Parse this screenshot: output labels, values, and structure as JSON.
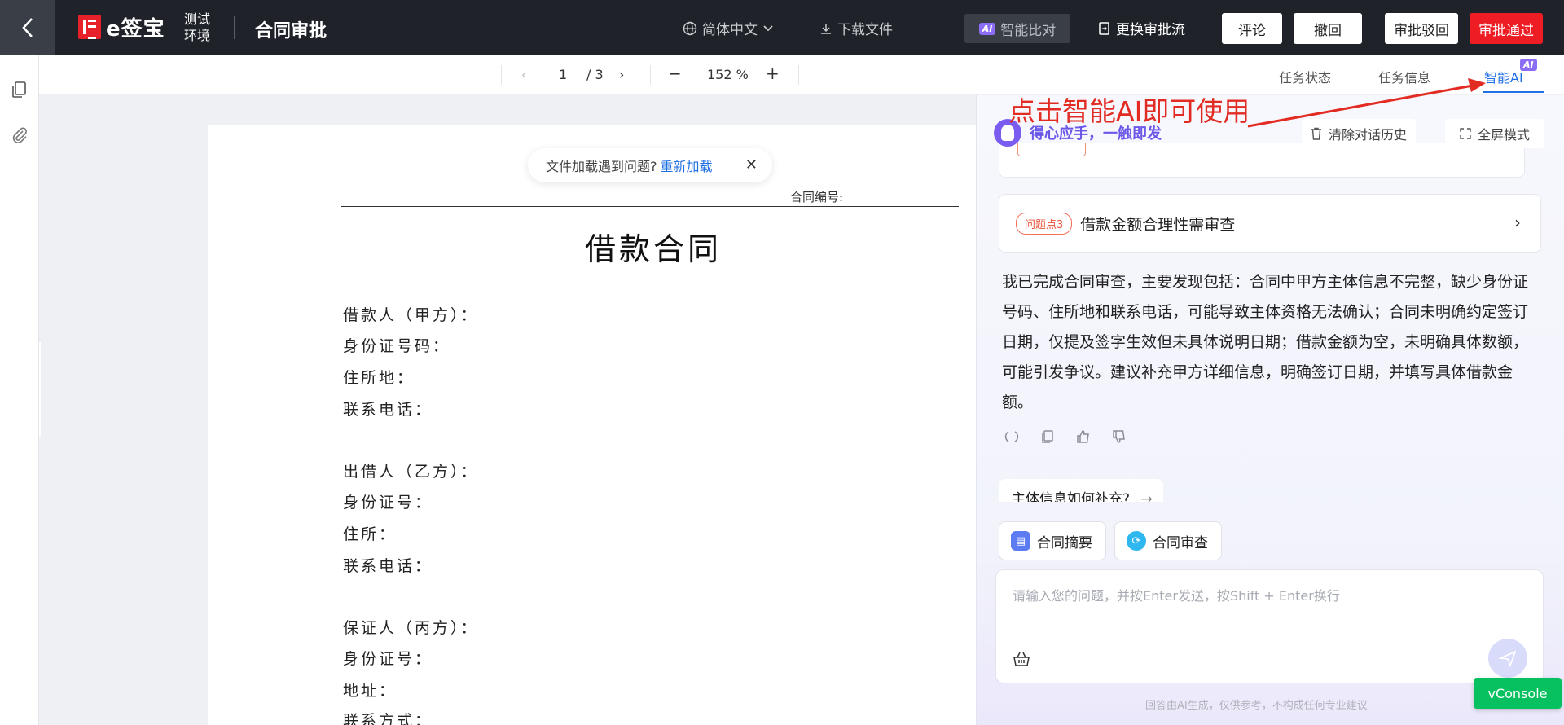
{
  "topbar": {
    "logo_text": "e签宝",
    "env_label": "测试环境",
    "title": "合同审批",
    "language": "简体中文",
    "download": "下载文件",
    "ai_badge": "AI",
    "ai_compare": "智能比对",
    "change_flow": "更换审批流",
    "buttons": {
      "comment": "评论",
      "withdraw": "撤回",
      "reject": "审批驳回",
      "approve": "审批通过"
    },
    "colors": {
      "bar": "#1f2329",
      "approve": "#ee1d23"
    }
  },
  "viewer": {
    "current_page": "1",
    "total_pages": "/ 3",
    "zoom": "152 %"
  },
  "right_tabs": {
    "task_status": "任务状态",
    "task_info": "任务信息",
    "smart_ai": "智能AI",
    "ai_superscript": "AI"
  },
  "toast": {
    "message": "文件加载遇到问题?",
    "action": "重新加载"
  },
  "document": {
    "contract_no_label": "合同编号:",
    "title": "借款合同",
    "fields": [
      "借款人（甲方）：",
      "身份证号码：",
      "住所地：",
      "联系电话：",
      "出借人（乙方）：",
      "身份证号：",
      "住所：",
      "联系电话：",
      "保证人（丙方）：",
      "身份证号：",
      "地址：",
      "联系方式："
    ]
  },
  "ai_panel": {
    "slogan": "得心应手，一触即发",
    "clear_history": "清除对话历史",
    "fullscreen": "全屏模式",
    "issue": {
      "tag": "问题点3",
      "text": "借款金额合理性需审查"
    },
    "answer": "我已完成合同审查，主要发现包括：合同中甲方主体信息不完整，缺少身份证号码、住所地和联系电话，可能导致主体资格无法确认；合同未明确约定签订日期，仅提及签字生效但未具体说明日期；借款金额为空，未明确具体数额，可能引发争议。建议补充甲方详细信息，明确签订日期，并填写具体借款金额。",
    "suggestion": "主体信息如何补充?",
    "chips": {
      "summary": "合同摘要",
      "review": "合同审查"
    },
    "input_placeholder": "请输入您的问题，并按Enter发送，按Shift + Enter换行",
    "disclaimer": "回答由AI生成，仅供参考，不构成任何专业建议"
  },
  "vconsole": "vConsole",
  "annotation": "点击智能AI即可使用"
}
